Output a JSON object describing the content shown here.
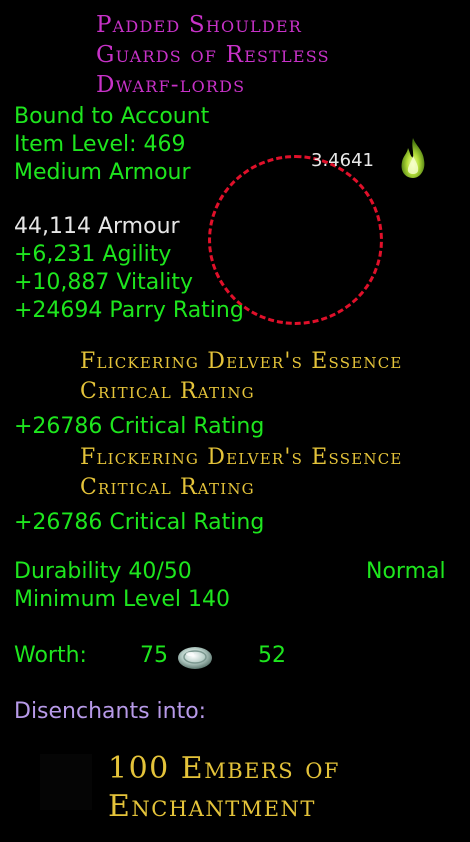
{
  "item": {
    "name_lines": [
      "Padded Shoulder",
      "Guards of Restless",
      "Dwarf-lords"
    ],
    "binding": "Bound to Account",
    "item_level": "Item Level: 469",
    "armour_type": "Medium Armour",
    "score": "3.4641"
  },
  "stats": {
    "armour": "44,114 Armour",
    "agility": "+6,231 Agility",
    "vitality": "+10,887 Vitality",
    "parry": "+24694 Parry Rating"
  },
  "essences": [
    {
      "name_line1": "Flickering Delver's Essence",
      "name_line2": "Critical Rating",
      "bonus": "+26786 Critical Rating"
    },
    {
      "name_line1": "Flickering Delver's Essence",
      "name_line2": "Critical Rating",
      "bonus": "+26786 Critical Rating"
    }
  ],
  "durability": {
    "label": "Durability 40/50",
    "state": "Normal"
  },
  "min_level": "Minimum Level 140",
  "worth": {
    "label": "Worth:",
    "gold": "75",
    "silver": "52",
    "coin_icon": "coin-icon"
  },
  "disenchant": {
    "label": "Disenchants into:",
    "result_line1": "100 Embers of",
    "result_line2": "Enchantment"
  },
  "colors": {
    "title": "#c832c8",
    "green": "#1ee61e",
    "gold": "#e4c33a",
    "purple": "#b79ae8",
    "ring": "#e0102a"
  }
}
